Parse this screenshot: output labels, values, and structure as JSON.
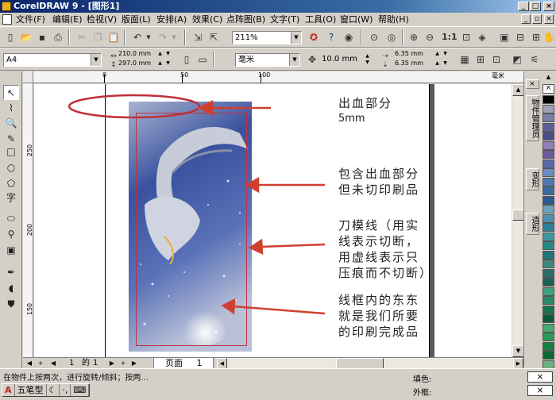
{
  "window": {
    "title": "CorelDRAW 9 - [图形1]"
  },
  "menu": [
    "文件(F)",
    "编辑(E)",
    "检视(V)",
    "版面(L)",
    "安排(A)",
    "效果(C)",
    "点阵图(B)",
    "文字(T)",
    "工具(O)",
    "窗口(W)",
    "帮助(H)"
  ],
  "toolbar": {
    "zoom": "211%"
  },
  "property_bar": {
    "paper": "A4",
    "width": "210.0 mm",
    "height": "297.0 mm",
    "units": "毫米",
    "nudge": "10.0 mm",
    "dup_x": "6.35 mm",
    "dup_y": "6.35 mm"
  },
  "ruler": {
    "h_labels": [
      "0",
      "50",
      "100"
    ],
    "h_unit": "毫米",
    "v_labels": [
      "250",
      "200",
      "150"
    ]
  },
  "annotations": [
    {
      "lines": [
        "出血部分",
        "5mm"
      ]
    },
    {
      "lines": [
        "包含出血部分",
        "但未切印刷品"
      ]
    },
    {
      "lines": [
        "刀模线（用实",
        "线表示切断，",
        "用虚线表示只",
        "压痕而不切断）"
      ]
    },
    {
      "lines": [
        "线框内的东东",
        "就是我们所要",
        "的印刷完成品"
      ]
    }
  ],
  "docker_tabs": [
    "物件管理员",
    "变形",
    "造形"
  ],
  "page_nav": {
    "current": "1",
    "of_label": "的",
    "total": "1",
    "tab_label": "页面",
    "tab_number": "1"
  },
  "status": {
    "message": "在物件上按两次，进行旋转/倾斜；按两...",
    "fill_label": "填色:",
    "outline_label": "外框:"
  },
  "ime": {
    "label": "五笔型"
  },
  "colors": {
    "title_bar": "#0a246a",
    "bleed_ellipse": "#c0303a",
    "arrow": "#d04030",
    "knife_line": "#c03040"
  },
  "palette": [
    "#000000",
    "#9da0b4",
    "#7b7fa8",
    "#5b5f98",
    "#4a4e8a",
    "#8f7fb8",
    "#6c5aa0",
    "#5a6aa8",
    "#6a8cc0",
    "#4f7ab0",
    "#3c6aa0",
    "#2a5a90",
    "#6ea0c0",
    "#5090b0",
    "#2e8098",
    "#3c98a0",
    "#2a8888",
    "#1e7878",
    "#408880",
    "#2a7068",
    "#1e6058",
    "#40a080",
    "#2a8868",
    "#1a7050",
    "#105838",
    "#48a870",
    "#309858",
    "#188040",
    "#0a6830",
    "#6cb080",
    "#3a8858"
  ]
}
